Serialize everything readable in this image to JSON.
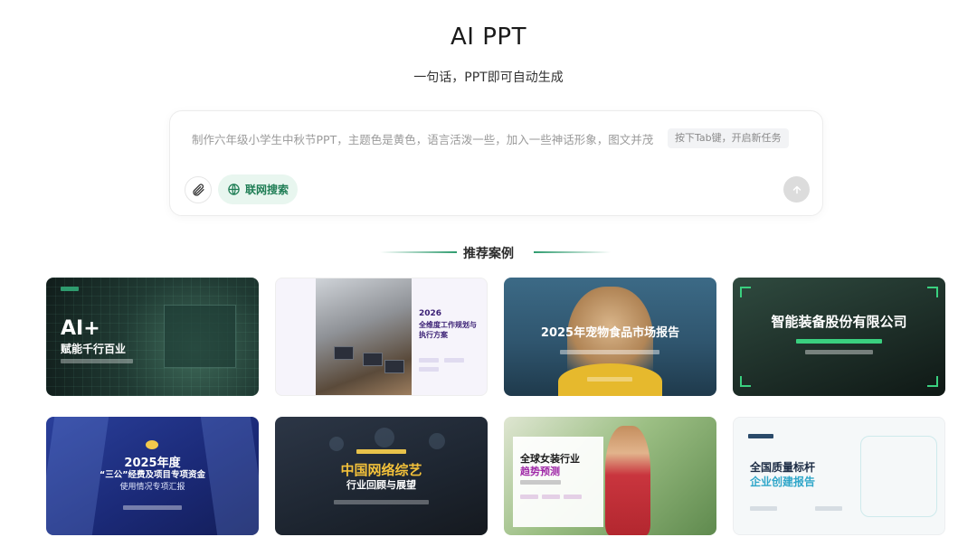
{
  "page": {
    "title": "AI PPT",
    "subtitle": "一句话，PPT即可自动生成"
  },
  "prompt": {
    "placeholder": "制作六年级小学生中秋节PPT，主题色是黄色，语言活泼一些，加入一些神话形象，图文并茂",
    "tab_hint": "按下Tab键，开启新任务",
    "web_search_label": "联网搜索",
    "icons": {
      "attach": "paperclip-icon",
      "web": "globe-icon",
      "send": "arrow-up-icon"
    }
  },
  "section": {
    "title": "推荐案例"
  },
  "colors": {
    "accent": "#2e9b6e",
    "accent_bg": "#e8f6ef"
  },
  "cases": [
    {
      "title": "AI+",
      "subtitle": "赋能千行百业"
    },
    {
      "title": "2026",
      "subtitle": "全维度工作规划与执行方案"
    },
    {
      "title": "2025年宠物食品市场报告"
    },
    {
      "title": "智能装备股份有限公司"
    },
    {
      "title": "2025年度",
      "subtitle": "“三公”经费及项目专项资金",
      "line3": "使用情况专项汇报"
    },
    {
      "title": "中国网络综艺",
      "subtitle": "行业回顾与展望"
    },
    {
      "title": "全球女装行业",
      "subtitle": "趋势预测"
    },
    {
      "title": "全国质量标杆",
      "subtitle": "企业创建报告"
    }
  ]
}
